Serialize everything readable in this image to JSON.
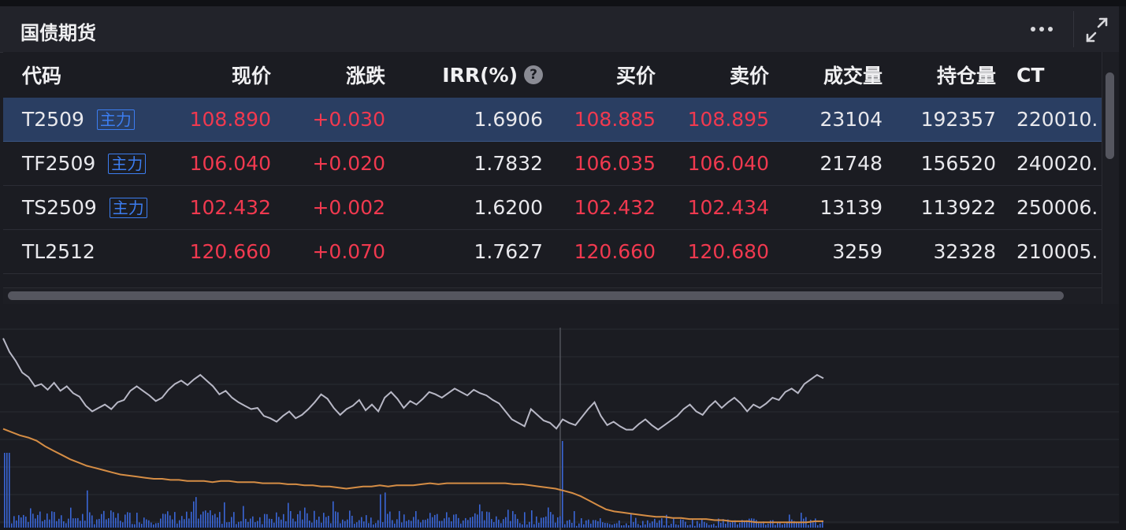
{
  "panel": {
    "title": "国债期货"
  },
  "table": {
    "headers": {
      "code": "代码",
      "price": "现价",
      "change": "涨跌",
      "irr": "IRR(%)",
      "irr_help": "?",
      "bid": "买价",
      "ask": "卖价",
      "volume": "成交量",
      "open_interest": "持仓量",
      "ctd": "CT"
    },
    "rows": [
      {
        "code": "T2509",
        "tag": "主力",
        "price": "108.890",
        "change": "+0.030",
        "irr": "1.6906",
        "bid": "108.885",
        "ask": "108.895",
        "volume": "23104",
        "open_interest": "192357",
        "ctd": "220010.",
        "selected": true
      },
      {
        "code": "TF2509",
        "tag": "主力",
        "price": "106.040",
        "change": "+0.020",
        "irr": "1.7832",
        "bid": "106.035",
        "ask": "106.040",
        "volume": "21748",
        "open_interest": "156520",
        "ctd": "240020."
      },
      {
        "code": "TS2509",
        "tag": "主力",
        "price": "102.432",
        "change": "+0.002",
        "irr": "1.6200",
        "bid": "102.432",
        "ask": "102.434",
        "volume": "13139",
        "open_interest": "113922",
        "ctd": "250006."
      },
      {
        "code": "TL2512",
        "tag": "",
        "price": "120.660",
        "change": "+0.070",
        "irr": "1.7627",
        "bid": "120.660",
        "ask": "120.680",
        "volume": "3259",
        "open_interest": "32328",
        "ctd": "210005."
      }
    ]
  },
  "colors": {
    "up": "#f0394f",
    "price_line": "#b8b8c6",
    "avg_line": "#d58d45",
    "volume_bar": "#3a66d6",
    "selected_row": "#2a3e62"
  },
  "icons": {
    "more": "more-horizontal-icon",
    "expand": "expand-icon",
    "help": "help-circle-icon"
  },
  "chart_data": {
    "type": "line",
    "series": [
      {
        "values": [
          0.92,
          0.8,
          0.72,
          0.62,
          0.58,
          0.5,
          0.52,
          0.47,
          0.53,
          0.46,
          0.5,
          0.44,
          0.41,
          0.33,
          0.28,
          0.31,
          0.34,
          0.3,
          0.36,
          0.38,
          0.46,
          0.5,
          0.46,
          0.42,
          0.37,
          0.4,
          0.47,
          0.52,
          0.55,
          0.51,
          0.56,
          0.6,
          0.55,
          0.5,
          0.43,
          0.46,
          0.4,
          0.36,
          0.33,
          0.3,
          0.31,
          0.24,
          0.22,
          0.19,
          0.24,
          0.28,
          0.22,
          0.25,
          0.3,
          0.36,
          0.43,
          0.39,
          0.31,
          0.25,
          0.3,
          0.33,
          0.38,
          0.29,
          0.34,
          0.28,
          0.4,
          0.45,
          0.39,
          0.31,
          0.37,
          0.34,
          0.39,
          0.45,
          0.43,
          0.4,
          0.44,
          0.48,
          0.45,
          0.42,
          0.47,
          0.44,
          0.42,
          0.38,
          0.35,
          0.28,
          0.21,
          0.18,
          0.15,
          0.3,
          0.25,
          0.2,
          0.18,
          0.13,
          0.21,
          0.18,
          0.16,
          0.23,
          0.3,
          0.36,
          0.24,
          0.16,
          0.19,
          0.15,
          0.12,
          0.12,
          0.17,
          0.21,
          0.16,
          0.12,
          0.16,
          0.2,
          0.24,
          0.3,
          0.34,
          0.28,
          0.25,
          0.32,
          0.37,
          0.31,
          0.36,
          0.4,
          0.35,
          0.28,
          0.34,
          0.31,
          0.35,
          0.4,
          0.38,
          0.45,
          0.48,
          0.44,
          0.52,
          0.56,
          0.6,
          0.57
        ]
      },
      {
        "values": [
          0.88,
          0.85,
          0.82,
          0.8,
          0.77,
          0.72,
          0.68,
          0.64,
          0.6,
          0.57,
          0.54,
          0.52,
          0.5,
          0.48,
          0.46,
          0.45,
          0.44,
          0.43,
          0.42,
          0.42,
          0.41,
          0.41,
          0.4,
          0.4,
          0.4,
          0.39,
          0.4,
          0.4,
          0.39,
          0.39,
          0.39,
          0.38,
          0.38,
          0.38,
          0.37,
          0.37,
          0.36,
          0.36,
          0.35,
          0.35,
          0.34,
          0.33,
          0.34,
          0.35,
          0.35,
          0.36,
          0.35,
          0.36,
          0.36,
          0.36,
          0.37,
          0.38,
          0.37,
          0.38,
          0.38,
          0.38,
          0.38,
          0.38,
          0.38,
          0.38,
          0.38,
          0.37,
          0.37,
          0.36,
          0.35,
          0.34,
          0.33,
          0.31,
          0.29,
          0.26,
          0.22,
          0.18,
          0.14,
          0.12,
          0.11,
          0.1,
          0.09,
          0.08,
          0.07,
          0.07,
          0.06,
          0.06,
          0.05,
          0.05,
          0.05,
          0.04,
          0.04,
          0.03,
          0.03,
          0.03,
          0.02,
          0.02,
          0.02,
          0.02,
          0.02,
          0.02,
          0.02,
          0.03,
          0.03
        ]
      }
    ],
    "grid": true,
    "vertical_marker": true
  }
}
